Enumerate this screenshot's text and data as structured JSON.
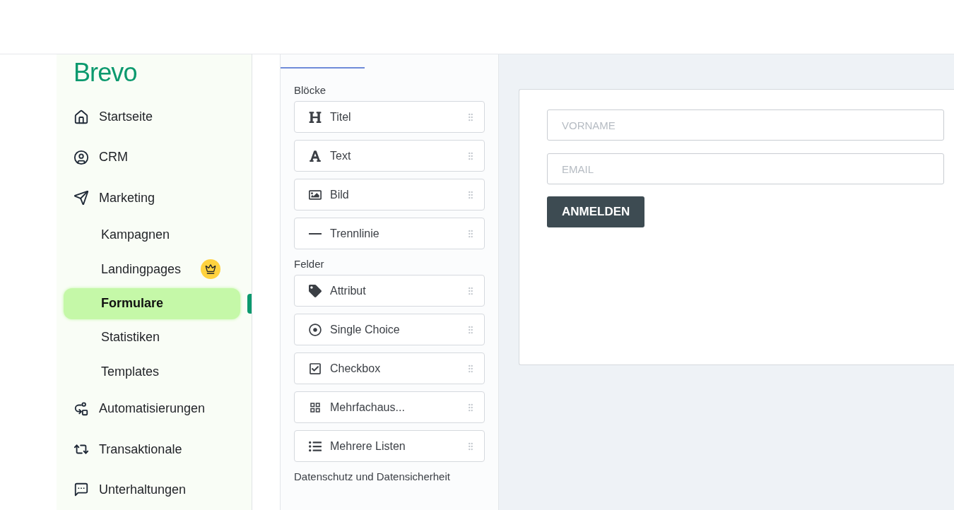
{
  "brand": {
    "name": "Brevo"
  },
  "nav": [
    {
      "label": "Startseite",
      "kind": "main",
      "selected": false
    },
    {
      "label": "CRM",
      "kind": "main",
      "selected": false
    },
    {
      "label": "Marketing",
      "kind": "main",
      "selected": false
    },
    {
      "label": "Kampagnen",
      "kind": "sub",
      "selected": false
    },
    {
      "label": "Landingpages",
      "kind": "sub",
      "selected": false,
      "premium": true
    },
    {
      "label": "Formulare",
      "kind": "sub",
      "selected": true
    },
    {
      "label": "Statistiken",
      "kind": "sub",
      "selected": false
    },
    {
      "label": "Templates",
      "kind": "sub",
      "selected": false
    },
    {
      "label": "Automatisierungen",
      "kind": "main",
      "selected": false
    },
    {
      "label": "Transaktionale",
      "kind": "main",
      "selected": false
    },
    {
      "label": "Unterhaltungen",
      "kind": "main",
      "selected": false
    }
  ],
  "sections": [
    {
      "title": "Blöcke",
      "items": [
        {
          "label": "Titel",
          "kind": "heading"
        },
        {
          "label": "Text",
          "kind": "text"
        },
        {
          "label": "Bild",
          "kind": "image"
        },
        {
          "label": "Trennlinie",
          "kind": "divider"
        }
      ]
    },
    {
      "title": "Felder",
      "items": [
        {
          "label": "Attribut",
          "kind": "tag"
        },
        {
          "label": "Single Choice",
          "kind": "radio"
        },
        {
          "label": "Checkbox",
          "kind": "checkbox"
        },
        {
          "label": "Mehrfachaus...",
          "kind": "grid"
        },
        {
          "label": "Mehrere Listen",
          "kind": "list"
        }
      ]
    },
    {
      "title": "Datenschutz und Datensicherheit"
    }
  ],
  "form": {
    "fields": [
      {
        "placeholder": "VORNAME"
      },
      {
        "placeholder": "EMAIL"
      }
    ],
    "submit": "ANMELDEN"
  }
}
